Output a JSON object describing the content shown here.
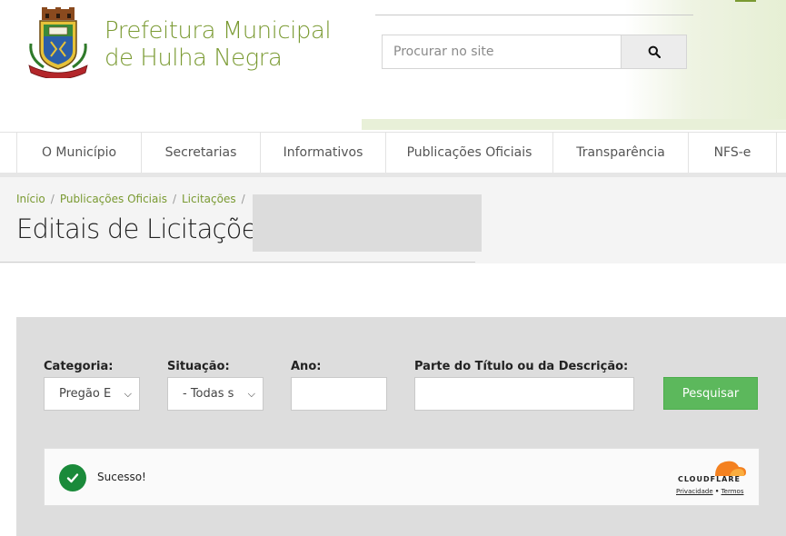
{
  "header": {
    "brand_line1": "Prefeitura Municipal",
    "brand_line2": "de Hulha Negra",
    "search_placeholder": "Procurar no site",
    "colors": {
      "brand": "#7a9a32",
      "header_band": "#e8f0d8"
    }
  },
  "nav": {
    "items": [
      {
        "label": "O Município"
      },
      {
        "label": "Secretarias"
      },
      {
        "label": "Informativos"
      },
      {
        "label": "Publicações Oficiais"
      },
      {
        "label": "Transparência"
      },
      {
        "label": "NFS-e"
      }
    ]
  },
  "breadcrumb": {
    "items": [
      "Início",
      "Publicações Oficiais",
      "Licitações"
    ],
    "separator": "/"
  },
  "page_title": "Editais de Licitações",
  "filters": {
    "categoria": {
      "label": "Categoria:",
      "value": "Pregão E"
    },
    "situacao": {
      "label": "Situação:",
      "value": "- Todas s"
    },
    "ano": {
      "label": "Ano:",
      "value": ""
    },
    "descricao": {
      "label": "Parte do Título ou da Descrição:",
      "value": ""
    },
    "search_button": "Pesquisar",
    "colors": {
      "button": "#5cb85c",
      "panel": "#dddddd"
    }
  },
  "captcha": {
    "status": "Sucesso!",
    "provider": "CLOUDFLARE",
    "privacy_link": "Privacidade",
    "separator": "•",
    "terms_link": "Termos",
    "colors": {
      "check": "#1a8a3a",
      "cloud": "#f48120"
    }
  }
}
